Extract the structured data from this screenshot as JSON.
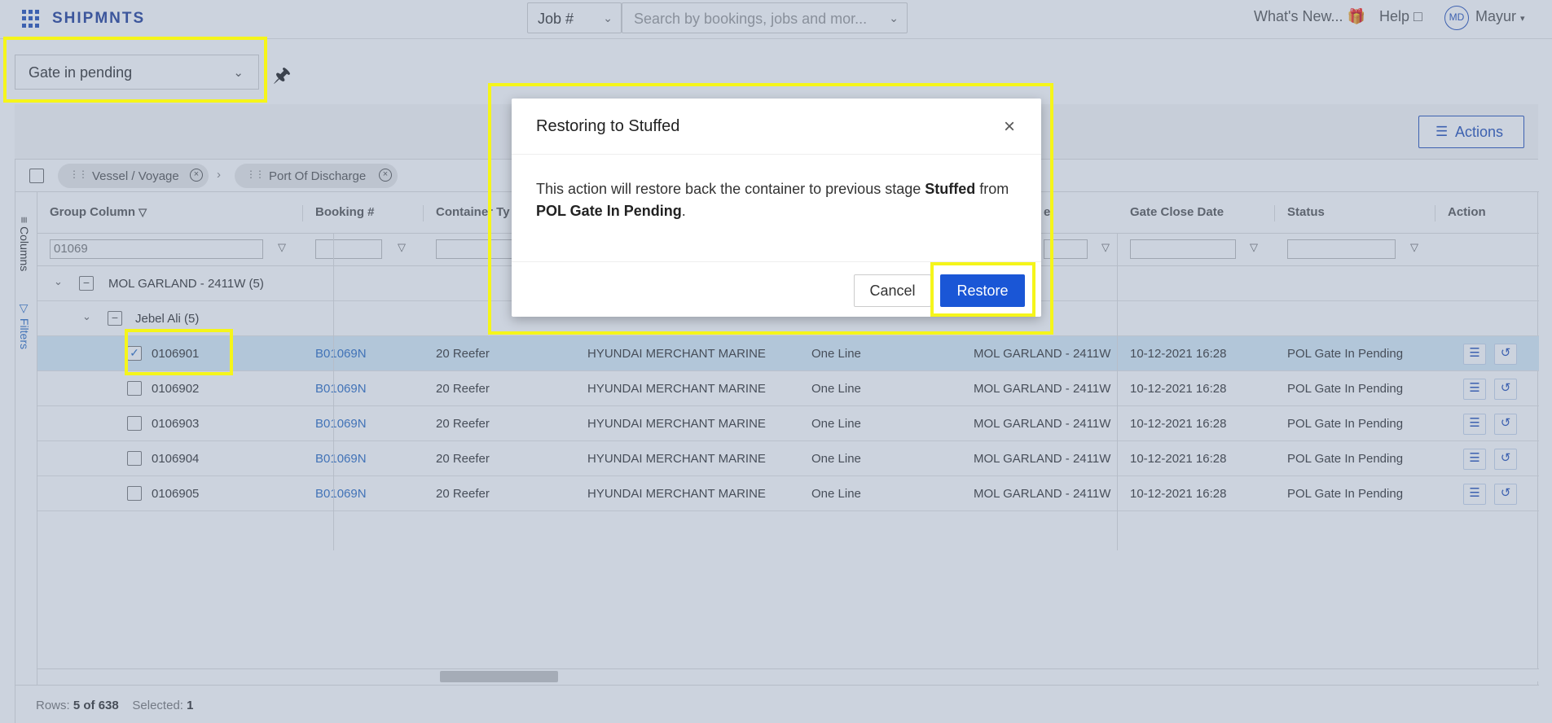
{
  "app": {
    "brand": "SHIPMNTS"
  },
  "topbar": {
    "job_select": "Job #",
    "search_placeholder": "Search by bookings, jobs and mor...",
    "whats_new": "What's New...",
    "help": "Help",
    "avatar_initials": "MD",
    "username": "Mayur"
  },
  "view": {
    "selected": "Gate in pending"
  },
  "toolbar": {
    "actions_label": "Actions"
  },
  "group_bar": {
    "chips": [
      "Vessel / Voyage",
      "Port Of Discharge"
    ]
  },
  "side_tabs": {
    "columns": "Columns",
    "filters": "Filters"
  },
  "columns": {
    "group": "Group Column",
    "booking": "Booking #",
    "container_type": "Container Ty",
    "vessel_partial": "e",
    "gate_close": "Gate Close Date",
    "status": "Status",
    "action": "Action"
  },
  "filters": {
    "group_value": "01069"
  },
  "groups": {
    "level1": "MOL GARLAND - 2411W (5)",
    "level2": "Jebel Ali (5)"
  },
  "rows": [
    {
      "container": "0106901",
      "booking": "B01069N",
      "type": "20 Reefer",
      "carrier": "HYUNDAI MERCHANT MARINE",
      "line": "One Line",
      "vessel": "MOL GARLAND - 2411W",
      "gate_close": "10-12-2021 16:28",
      "status": "POL Gate In Pending",
      "checked": true
    },
    {
      "container": "0106902",
      "booking": "B01069N",
      "type": "20 Reefer",
      "carrier": "HYUNDAI MERCHANT MARINE",
      "line": "One Line",
      "vessel": "MOL GARLAND - 2411W",
      "gate_close": "10-12-2021 16:28",
      "status": "POL Gate In Pending",
      "checked": false
    },
    {
      "container": "0106903",
      "booking": "B01069N",
      "type": "20 Reefer",
      "carrier": "HYUNDAI MERCHANT MARINE",
      "line": "One Line",
      "vessel": "MOL GARLAND - 2411W",
      "gate_close": "10-12-2021 16:28",
      "status": "POL Gate In Pending",
      "checked": false
    },
    {
      "container": "0106904",
      "booking": "B01069N",
      "type": "20 Reefer",
      "carrier": "HYUNDAI MERCHANT MARINE",
      "line": "One Line",
      "vessel": "MOL GARLAND - 2411W",
      "gate_close": "10-12-2021 16:28",
      "status": "POL Gate In Pending",
      "checked": false
    },
    {
      "container": "0106905",
      "booking": "B01069N",
      "type": "20 Reefer",
      "carrier": "HYUNDAI MERCHANT MARINE",
      "line": "One Line",
      "vessel": "MOL GARLAND - 2411W",
      "gate_close": "10-12-2021 16:28",
      "status": "POL Gate In Pending",
      "checked": false
    }
  ],
  "footer": {
    "rows_label": "Rows:",
    "rows_value": "5 of 638",
    "selected_label": "Selected:",
    "selected_value": "1"
  },
  "modal": {
    "title": "Restoring to Stuffed",
    "body_prefix": "This action will restore back the container to previous stage ",
    "body_stage": "Stuffed",
    "body_mid": " from ",
    "body_from": "POL Gate In Pending",
    "body_suffix": ".",
    "cancel": "Cancel",
    "restore": "Restore"
  },
  "colors": {
    "accent": "#1a56d6",
    "brand": "#23409a",
    "highlight": "#f5f51a",
    "link": "#2b6cc4"
  }
}
